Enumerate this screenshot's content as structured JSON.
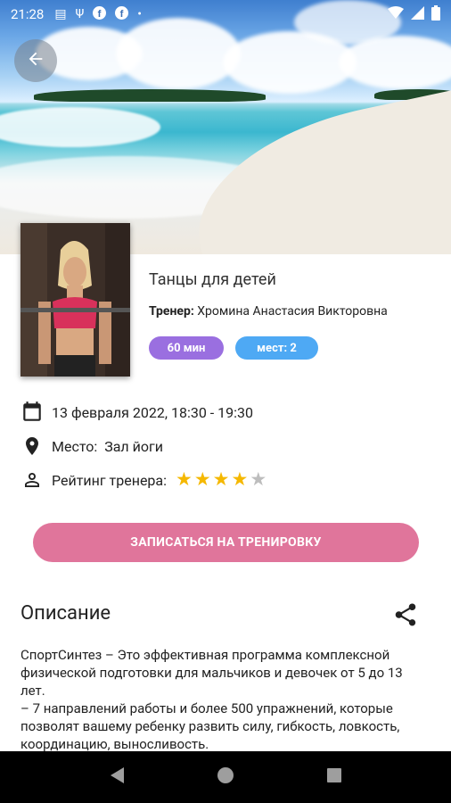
{
  "status_bar": {
    "time": "21:28",
    "left_icons": [
      "message-icon",
      "usb-icon",
      "facebook-icon",
      "facebook-icon",
      "dot-icon"
    ],
    "right_icons": [
      "wifi-icon",
      "signal-icon",
      "battery-icon"
    ]
  },
  "header": {
    "back_icon": "arrow-left-icon"
  },
  "training": {
    "title": "Танцы для детей",
    "trainer_label": "Тренер:",
    "trainer_name": "Хромина Анастасия Викторовна",
    "duration": "60 мин",
    "places": "мест: 2",
    "date_time": "13 февраля 2022, 18:30 - 19:30",
    "place_label": "Место:",
    "place_value": "Зал йоги",
    "rating_label": "Рейтинг тренера:",
    "rating": 4,
    "rating_max": 5
  },
  "actions": {
    "signup_label": "ЗАПИСАТЬСЯ НА ТРЕНИРОВКУ"
  },
  "description": {
    "title": "Описание",
    "paragraphs": [
      "СпортСинтез – Это эффективная программа комплексной физической подготовки для мальчиков и девочек от 5 до 13 лет.",
      "– 7 направлений работы и более 500 упражнений, которые позволят вашему ребенку развить силу, гибкость, ловкость, координацию, выносливость."
    ]
  },
  "colors": {
    "cta": "#e0759b",
    "duration_chip": "#9a6fe0",
    "places_chip": "#4ea9f4",
    "star_on": "#f5b800",
    "star_off": "#bdbdbd"
  }
}
